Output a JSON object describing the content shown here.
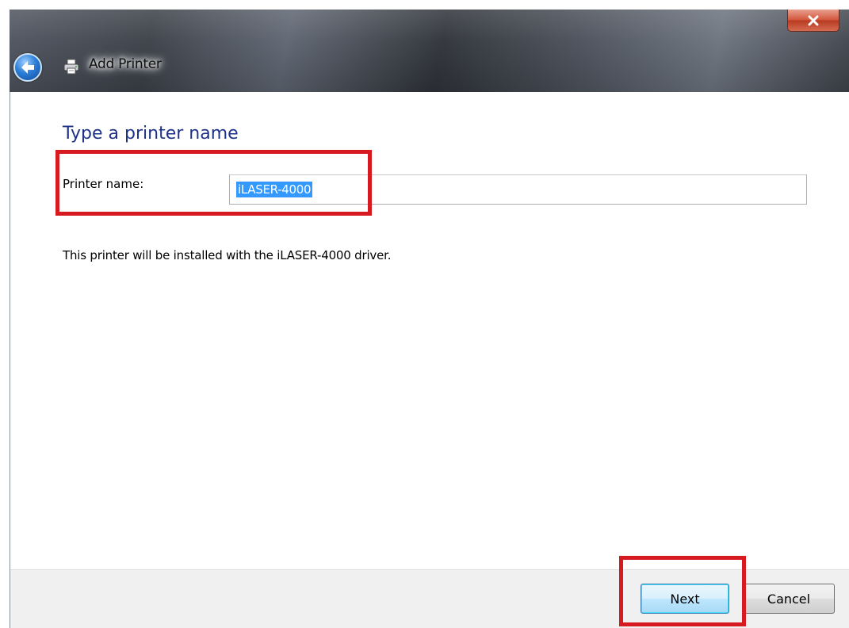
{
  "window": {
    "title": "Add Printer",
    "close_symbol": "x"
  },
  "page": {
    "heading": "Type a printer name",
    "printer_name_label": "Printer name:",
    "printer_name_value": "iLASER-4000",
    "driver_message": "This printer will be installed with the iLASER-4000 driver."
  },
  "footer": {
    "next_label": "Next",
    "cancel_label": "Cancel"
  },
  "icons": [
    "back-arrow-icon",
    "printer-icon",
    "close-icon"
  ],
  "colors": {
    "heading": "#1e3287",
    "selection": "#3399ff",
    "highlight_box": "#d71920",
    "close_button": "#c8472d"
  }
}
